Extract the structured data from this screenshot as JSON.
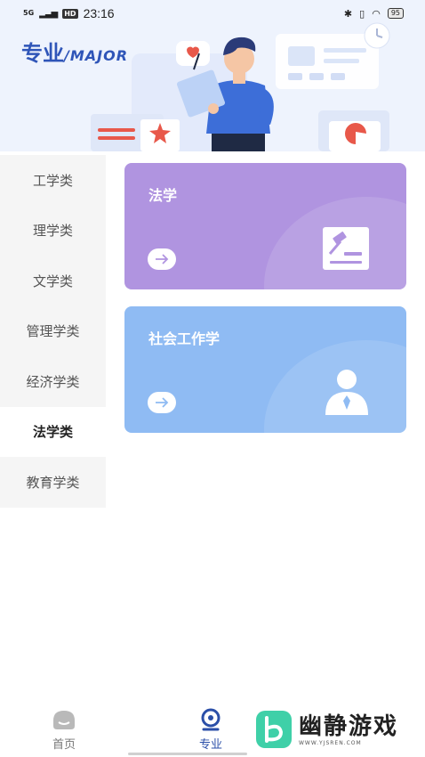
{
  "status_bar": {
    "signal": "5G",
    "hd": "HD",
    "time": "23:16",
    "battery": "95"
  },
  "header": {
    "title_cn": "专业",
    "title_en": "/MAJOR"
  },
  "sidebar": {
    "items": [
      {
        "label": "工学类"
      },
      {
        "label": "理学类"
      },
      {
        "label": "文学类"
      },
      {
        "label": "管理学类"
      },
      {
        "label": "经济学类"
      },
      {
        "label": "法学类"
      },
      {
        "label": "教育学类"
      }
    ],
    "active_index": 5
  },
  "cards": [
    {
      "title": "法学",
      "color": "#b094e0",
      "icon": "gavel-book-icon"
    },
    {
      "title": "社会工作学",
      "color": "#8fbbf3",
      "icon": "person-icon"
    }
  ],
  "bottom_nav": {
    "home_label": "首页",
    "major_label": "专业"
  },
  "watermark": {
    "text_cn": "幽静游戏",
    "url": "WWW.YJSREN.COM"
  },
  "colors": {
    "accent": "#2f55b8",
    "header_bg": "#eef3fd",
    "card_purple": "#b094e0",
    "card_blue": "#8fbbf3"
  }
}
